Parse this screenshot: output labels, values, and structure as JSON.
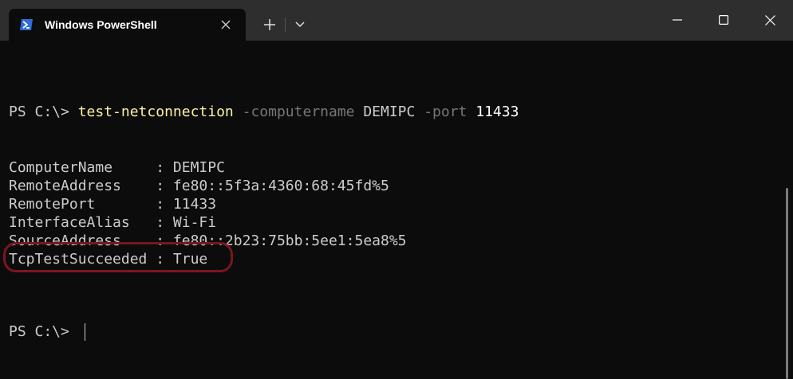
{
  "window": {
    "tab_title": "Windows PowerShell",
    "icons": {
      "tab": "powershell-icon",
      "close_tab": "close-icon",
      "new_tab": "plus-icon",
      "dropdown": "chevron-down-icon",
      "minimize": "minimize-icon",
      "maximize": "maximize-icon",
      "close": "close-icon"
    },
    "colors": {
      "titlebar": "#2e2e2e",
      "terminal_bg": "#0c0c0c",
      "highlight": "#7a1620"
    }
  },
  "terminal": {
    "command_line": {
      "prompt": "PS C:\\> ",
      "command": "test-netconnection",
      "param1": " -computername",
      "value1": " DEMIPC",
      "param2": " -port",
      "value2": " 11433"
    },
    "output": [
      "ComputerName     : DEMIPC",
      "RemoteAddress    : fe80::5f3a:4360:68:45fd%5",
      "RemotePort       : 11433",
      "InterfaceAlias   : Wi-Fi",
      "SourceAddress    : fe80::2b23:75bb:5ee1:5ea8%5",
      "TcpTestSucceeded : True"
    ],
    "final_prompt": "PS C:\\> "
  }
}
